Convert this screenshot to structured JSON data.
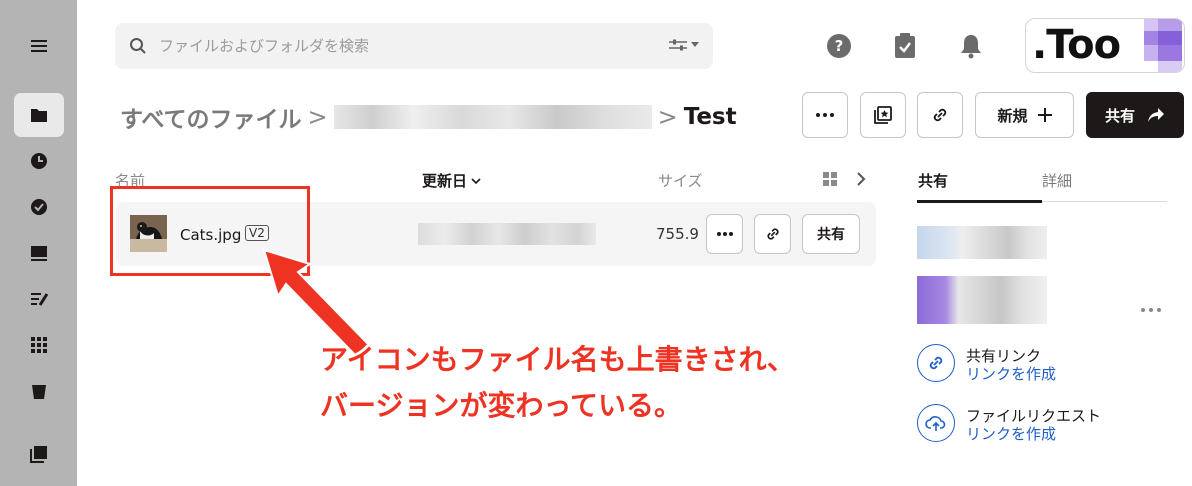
{
  "search": {
    "placeholder": "ファイルおよびフォルダを検索"
  },
  "breadcrumb": {
    "root": "すべてのファイル",
    "sep": ">",
    "current": "Test"
  },
  "header_buttons": {
    "new_label": "新規",
    "share_label": "共有"
  },
  "table": {
    "col_name": "名前",
    "col_modified": "更新日",
    "col_size": "サイズ",
    "rows": [
      {
        "name": "Cats.jpg",
        "version": "V2",
        "size": "755.9",
        "share_label": "共有"
      }
    ]
  },
  "annotation": {
    "line1": "アイコンもファイル名も上書きされ、",
    "line2": "バージョンが変わっている。",
    "color": "#ee3322"
  },
  "panel": {
    "tab_share": "共有",
    "tab_details": "詳細",
    "share_link_title": "共有リンク",
    "share_link_action": "リンクを作成",
    "file_request_title": "ファイルリクエスト",
    "file_request_action": "リンクを作成"
  },
  "logo": {
    "text": ".Too"
  },
  "colors": {
    "accent_blue": "#1f5fc6",
    "rail": "#b4b4b4",
    "dark_button": "#1e1919"
  }
}
